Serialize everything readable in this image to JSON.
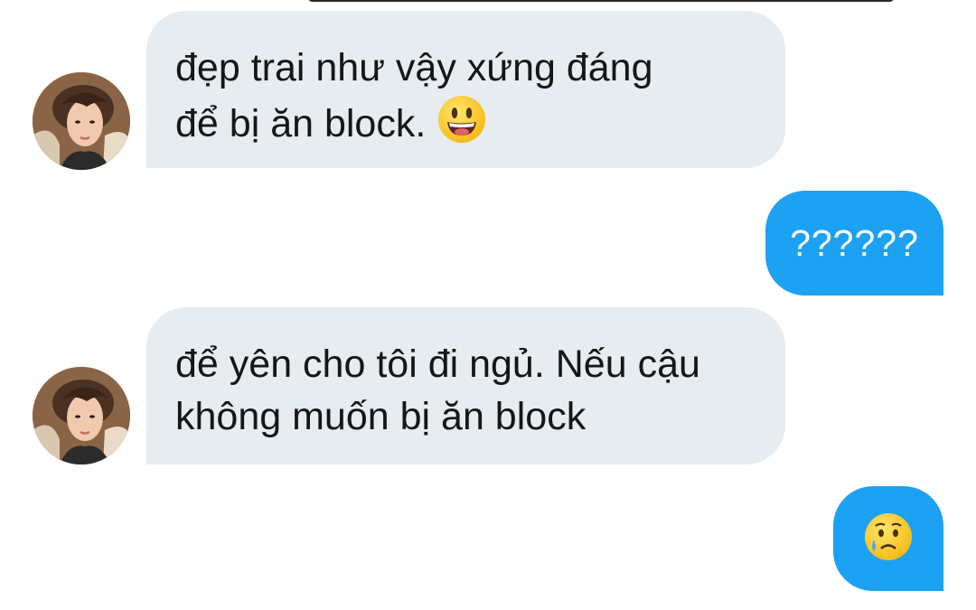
{
  "messages": [
    {
      "side": "received",
      "text_line1": "đẹp trai như vậy xứng đáng",
      "text_line2": "để bị ăn block.",
      "trailing_icon": "grinning-face-emoji-icon",
      "avatar_icon": "profile-avatar"
    },
    {
      "side": "sent",
      "text": "??????"
    },
    {
      "side": "received",
      "text_line1": "để yên cho tôi đi ngủ. Nếu cậu",
      "text_line2": "không muốn bị ăn block",
      "avatar_icon": "profile-avatar"
    },
    {
      "side": "sent",
      "icon": "crying-face-emoji-icon"
    }
  ],
  "colors": {
    "received_bubble": "#e6ecf0",
    "sent_bubble": "#1da1f2",
    "received_text": "#14171a",
    "sent_text": "#ffffff"
  }
}
